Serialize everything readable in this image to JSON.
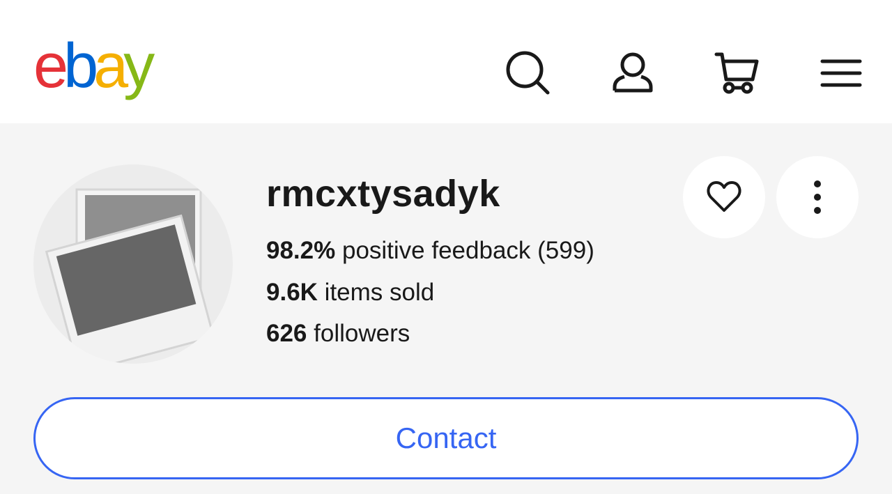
{
  "header": {
    "logo": {
      "e": "e",
      "b": "b",
      "a": "a",
      "y": "y"
    },
    "icons": [
      "search-icon",
      "account-icon",
      "cart-icon",
      "menu-icon"
    ]
  },
  "colors": {
    "logo_e": "#e53238",
    "logo_b": "#0064d2",
    "logo_a": "#f5af02",
    "logo_y": "#86b817",
    "accent": "#3665f3",
    "background": "#f5f5f5"
  },
  "seller": {
    "username": "rmcxtysadyk",
    "feedback_percent": "98.2%",
    "feedback_text": " positive feedback (599)",
    "items_sold_value": "9.6K",
    "items_sold_text": " items sold",
    "followers_value": "626",
    "followers_text": " followers"
  },
  "actions": {
    "save_icon": "heart-icon",
    "more_icon": "more-vertical-icon",
    "contact_label": "Contact"
  }
}
